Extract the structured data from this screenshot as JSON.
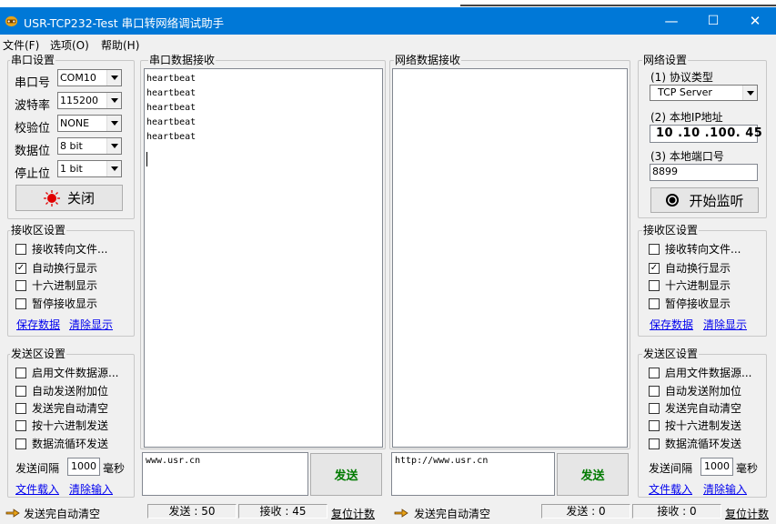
{
  "window": {
    "title": "USR-TCP232-Test 串口转网络调试助手",
    "minimize": "—",
    "maximize": "☐",
    "close": "✕"
  },
  "menu": {
    "items": [
      "文件(F)",
      "选项(O)",
      "帮助(H)"
    ]
  },
  "serial": {
    "title": "串口设置",
    "port_label": "串口号",
    "port_value": "COM10",
    "baud_label": "波特率",
    "baud_value": "115200",
    "parity_label": "校验位",
    "parity_value": "NONE",
    "data_label": "数据位",
    "data_value": "8 bit",
    "stop_label": "停止位",
    "stop_value": "1 bit",
    "close_button": "关闭"
  },
  "serial_recv": {
    "title": "串口数据接收",
    "lines": [
      "heartbeat",
      "heartbeat",
      "heartbeat",
      "heartbeat",
      "heartbeat"
    ]
  },
  "net_recv": {
    "title": "网络数据接收"
  },
  "left_recv_settings": {
    "title": "接收区设置",
    "options": [
      {
        "label": "接收转向文件...",
        "checked": false
      },
      {
        "label": "自动换行显示",
        "checked": true
      },
      {
        "label": "十六进制显示",
        "checked": false
      },
      {
        "label": "暂停接收显示",
        "checked": false
      }
    ],
    "save_link": "保存数据",
    "clear_link": "清除显示"
  },
  "left_send_settings": {
    "title": "发送区设置",
    "options": [
      {
        "label": "启用文件数据源...",
        "checked": false
      },
      {
        "label": "自动发送附加位",
        "checked": false
      },
      {
        "label": "发送完自动清空",
        "checked": false
      },
      {
        "label": "按十六进制发送",
        "checked": false
      },
      {
        "label": "数据流循环发送",
        "checked": false
      }
    ],
    "interval_label": "发送间隔",
    "interval_value": "1000",
    "interval_unit": "毫秒",
    "load_link": "文件载入",
    "clear_link": "清除输入"
  },
  "serial_send": {
    "text": "www.usr.cn",
    "send_button": "发送"
  },
  "net_send": {
    "text": "http://www.usr.cn",
    "send_button": "发送"
  },
  "network": {
    "title": "网络设置",
    "protocol_label": "(1) 协议类型",
    "protocol_value": "TCP Server",
    "ip_label": "(2) 本地IP地址",
    "ip_value": "10 .10 .100. 45",
    "port_label": "(3) 本地端口号",
    "port_value": "8899",
    "listen_button": "开始监听"
  },
  "right_recv_settings": {
    "title": "接收区设置",
    "options": [
      {
        "label": "接收转向文件...",
        "checked": false
      },
      {
        "label": "自动换行显示",
        "checked": true
      },
      {
        "label": "十六进制显示",
        "checked": false
      },
      {
        "label": "暂停接收显示",
        "checked": false
      }
    ],
    "save_link": "保存数据",
    "clear_link": "清除显示"
  },
  "right_send_settings": {
    "title": "发送区设置",
    "options": [
      {
        "label": "启用文件数据源...",
        "checked": false
      },
      {
        "label": "自动发送附加位",
        "checked": false
      },
      {
        "label": "发送完自动清空",
        "checked": false
      },
      {
        "label": "按十六进制发送",
        "checked": false
      },
      {
        "label": "数据流循环发送",
        "checked": false
      }
    ],
    "interval_label": "发送间隔",
    "interval_value": "1000",
    "interval_unit": "毫秒",
    "load_link": "文件载入",
    "clear_link": "清除输入"
  },
  "status_left": {
    "text": "发送完自动清空",
    "sent": "发送 : 50",
    "recv": "接收 : 45",
    "reset": "复位计数"
  },
  "status_right": {
    "text": "发送完自动清空",
    "sent": "发送 : 0",
    "recv": "接收 : 0",
    "reset": "复位计数"
  },
  "colors": {
    "titlebar": "#0078d7",
    "link": "#0000ee",
    "send_button_text": "#007a00",
    "close_led": "#e00000"
  }
}
